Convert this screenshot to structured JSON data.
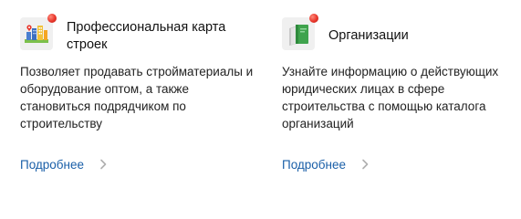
{
  "cards": [
    {
      "title": "Профессиональная карта строек",
      "description": "Позволяет продавать стройматериалы и оборудование оптом, а также становиться подрядчиком по строительству",
      "link_label": "Подробнее",
      "icon": "construction-map-icon",
      "has_notification": true
    },
    {
      "title": "Организации",
      "description": "Узнайте информацию о действующих юридических лицах в сфере строительства с помощью каталога организаций",
      "link_label": "Подробнее",
      "icon": "organizations-book-icon",
      "has_notification": true
    }
  ],
  "colors": {
    "link": "#1a5fa8",
    "notification": "#e8352a",
    "chevron": "#b0b0b0"
  }
}
